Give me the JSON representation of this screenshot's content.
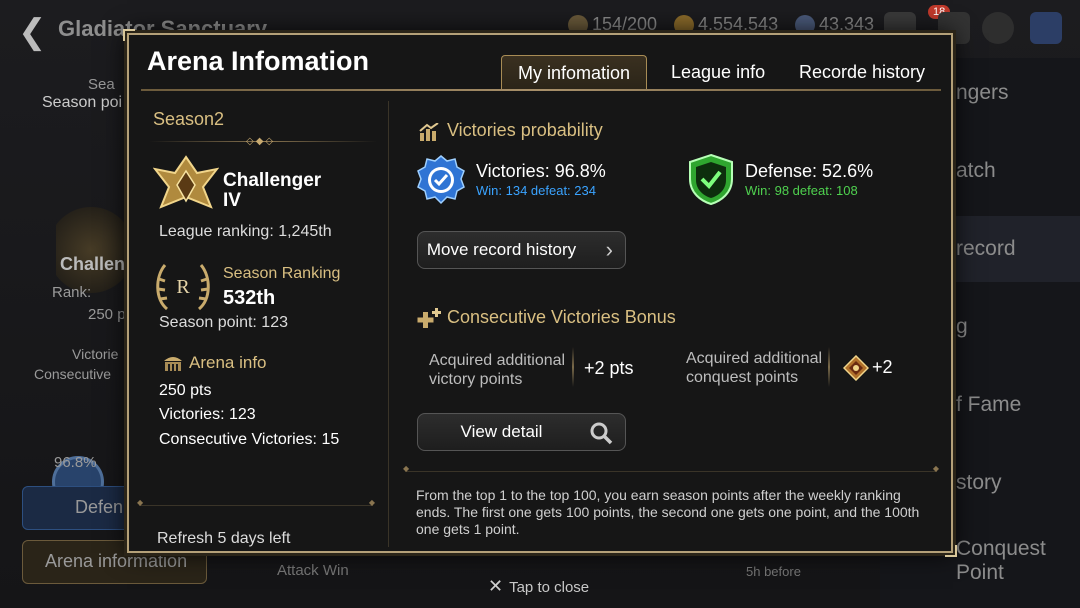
{
  "background": {
    "title": "Gladiator Sanctuary",
    "resources": [
      "154/200",
      "4,554,543",
      "43,343"
    ],
    "notification_count": "18",
    "right_menu": [
      "ngers",
      "atch",
      "record",
      "g",
      "f Fame",
      "story",
      "Conquest Point"
    ],
    "left_texts": {
      "season": "Sea",
      "season_point": "Season poi",
      "challenger": "Challen",
      "rank": "Rank:",
      "pts": "250 p",
      "victories": "Victorie",
      "consecutive": "Consecutive",
      "percent": "96.8%",
      "defense_btn": "Defen",
      "arena_btn": "Arena information"
    },
    "bottom_texts": [
      "Attack Win",
      "5h before"
    ]
  },
  "modal": {
    "title": "Arena Infomation",
    "tabs": [
      "My infomation",
      "League info",
      "Recorde history"
    ],
    "active_tab": 0,
    "season": "Season2",
    "tier_name": "Challenger",
    "tier_level": "IV",
    "league_ranking": "League ranking: 1,245th",
    "season_emblem_letter": "R",
    "season_ranking_label": "Season Ranking",
    "season_ranking_value": "532th",
    "season_point": "Season point: 123",
    "arena_info_label": "Arena info",
    "arena_pts": "250 pts",
    "arena_victories": "Victories: 123",
    "arena_consecutive": "Consecutive Victories: 15",
    "refresh": "Refresh 5 days left",
    "victories_probability_title": "Victories probability",
    "victories": {
      "title": "Victories: 96.8%",
      "sub": "Win: 134  defeat: 234",
      "color": "#3aa3ff"
    },
    "defense": {
      "title": "Defense: 52.6%",
      "sub": "Win: 98  defeat: 108",
      "color": "#4fd14f"
    },
    "move_record_button": "Move record history",
    "consecutive_bonus_title": "Consecutive Victories Bonus",
    "acquired_victory_label_1": "Acquired additional",
    "acquired_victory_label_2": "victory points",
    "acquired_victory_value": "+2 pts",
    "acquired_conquest_label_1": "Acquired additional",
    "acquired_conquest_label_2": "conquest points",
    "acquired_conquest_value": "+2",
    "view_detail_button": "View detail",
    "footnote": "From the top 1 to the top 100, you earn season points after the weekly ranking ends. The first one gets 100 points, the second one gets one point, and the 100th one gets 1 point.",
    "close_hint": "Tap to close",
    "accent_color": "#d9bf82",
    "border_color": "#b4a078"
  }
}
